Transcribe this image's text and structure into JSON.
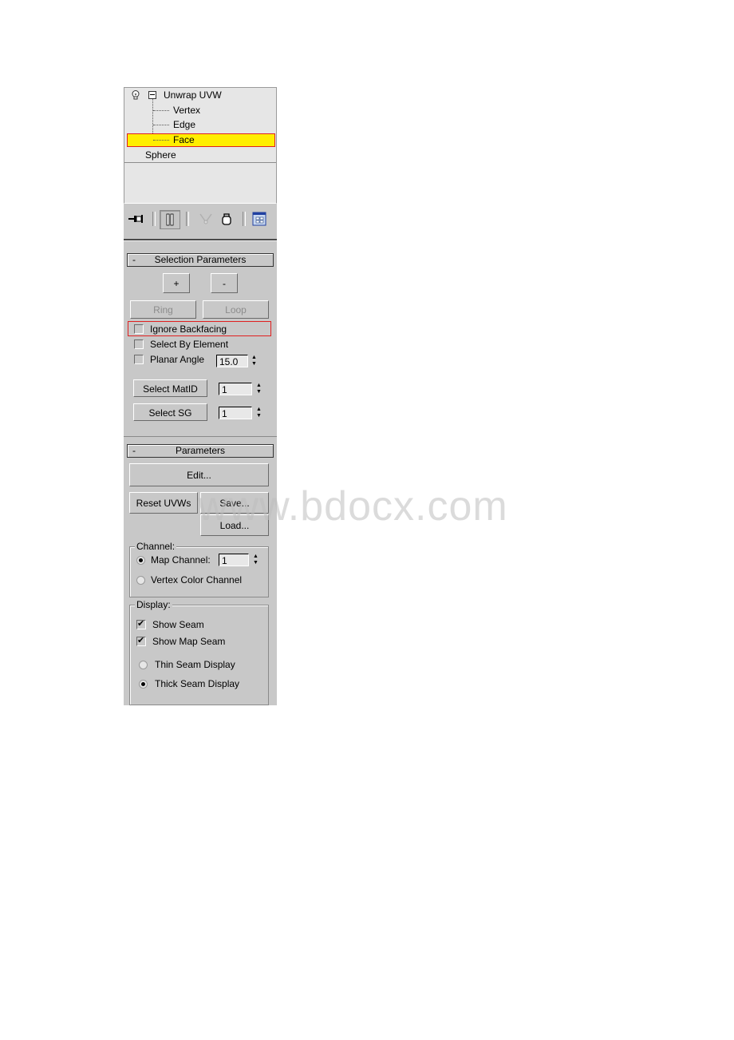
{
  "modifier_stack": {
    "items": [
      {
        "label": "Unwrap UVW",
        "level": 0,
        "expanded": true
      },
      {
        "label": "Vertex",
        "level": 1
      },
      {
        "label": "Edge",
        "level": 1
      },
      {
        "label": "Face",
        "level": 1,
        "selected": true
      },
      {
        "label": "Sphere",
        "level": 0
      }
    ],
    "highlight_color": "#ffee00"
  },
  "toolbar": {
    "icons": [
      "pin-stack-icon",
      "show-end-result-icon",
      "make-unique-icon",
      "remove-modifier-icon",
      "configure-modifier-sets-icon"
    ]
  },
  "selection_parameters": {
    "title": "Selection Parameters",
    "collapse_symbol": "-",
    "grow_label": "+",
    "shrink_label": "-",
    "ring_label": "Ring",
    "loop_label": "Loop",
    "ignore_backfacing": {
      "label": "Ignore Backfacing",
      "checked": false
    },
    "select_by_element": {
      "label": "Select By Element",
      "checked": false
    },
    "planar_angle": {
      "label": "Planar Angle",
      "checked": false,
      "value": "15.0"
    },
    "select_matid": {
      "label": "Select MatID",
      "value": "1"
    },
    "select_sg": {
      "label": "Select SG",
      "value": "1"
    }
  },
  "parameters": {
    "title": "Parameters",
    "collapse_symbol": "-",
    "edit_label": "Edit...",
    "reset_label": "Reset UVWs",
    "save_label": "Save...",
    "load_label": "Load...",
    "channel": {
      "group_label": "Channel:",
      "map_channel_label": "Map Channel:",
      "map_channel_value": "1",
      "map_channel_selected": true,
      "vertex_color_label": "Vertex Color Channel",
      "vertex_color_selected": false
    },
    "display": {
      "group_label": "Display:",
      "show_seam": {
        "label": "Show Seam",
        "checked": true
      },
      "show_map_seam": {
        "label": "Show Map Seam",
        "checked": true
      },
      "thin_seam": {
        "label": "Thin Seam Display",
        "selected": false
      },
      "thick_seam": {
        "label": "Thick Seam Display",
        "selected": true
      }
    }
  },
  "watermark": "www.bdocx.com"
}
